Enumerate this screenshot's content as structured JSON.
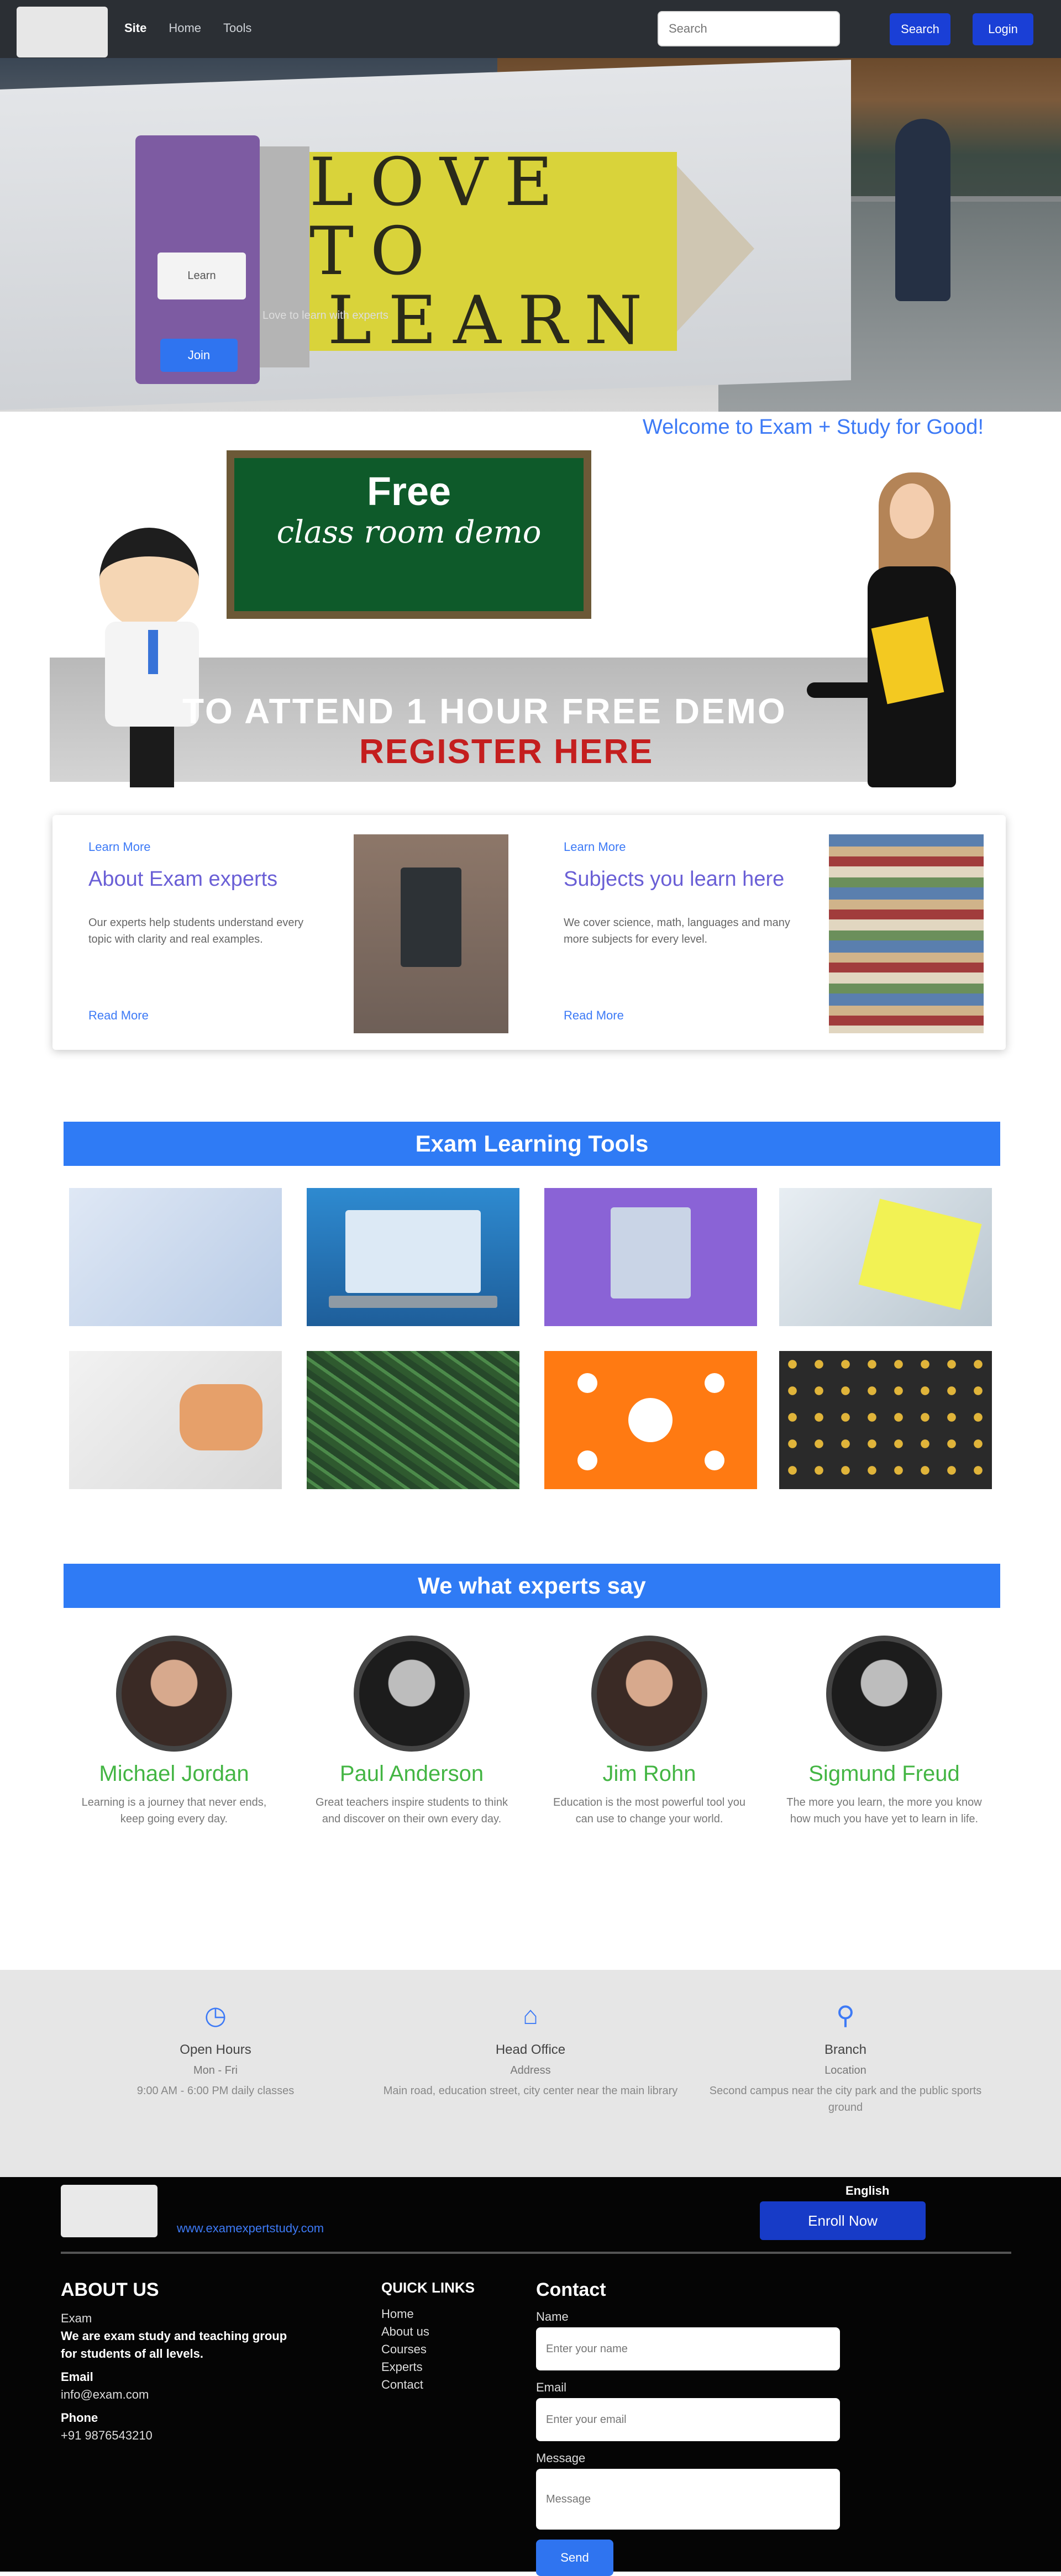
{
  "nav": {
    "links": [
      "Site",
      "Home",
      "Tools"
    ],
    "search_placeholder": "Search",
    "buttons": [
      "Search",
      "Login"
    ]
  },
  "hero": {
    "pencil_words": [
      "LOVE TO",
      "LEARN"
    ],
    "card_label": "Learn",
    "caption": "Love to learn with experts",
    "button_label": "Join",
    "welcome": "Welcome to Exam + Study for Good!"
  },
  "banner": {
    "chalk_line1": "Free",
    "chalk_line2": "class room demo",
    "line1": "TO ATTEND 1 HOUR FREE DEMO",
    "line2": "REGISTER HERE"
  },
  "info_cards": [
    {
      "tag": "Learn More",
      "title": "About Exam experts",
      "text": "Our experts help students understand every topic with clarity and real examples.",
      "more": "Read More"
    },
    {
      "tag": "Learn More",
      "title": "Subjects you learn here",
      "text": "We cover science, math, languages and many more subjects for every level.",
      "more": "Read More"
    }
  ],
  "sections": {
    "tools": "Exam Learning Tools",
    "experts": "We what experts say"
  },
  "tools": [
    "keyboard",
    "laptop",
    "certificate",
    "notes",
    "pencil-sketch",
    "chalkboard",
    "network",
    "gold-pattern"
  ],
  "experts": [
    {
      "name": "Michael Jordan",
      "quote": "Learning is a journey that never ends, keep going every day."
    },
    {
      "name": "Paul Anderson",
      "quote": "Great teachers inspire students to think and discover on their own every day."
    },
    {
      "name": "Jim Rohn",
      "quote": "Education is the most powerful tool you can use to change your world."
    },
    {
      "name": "Sigmund Freud",
      "quote": "The more you learn, the more you know how much you have yet to learn in life."
    }
  ],
  "contact_strip": [
    {
      "icon": "clock-icon",
      "title": "Open Hours",
      "sub": "Mon - Fri",
      "text": "9:00 AM - 6:00 PM daily classes"
    },
    {
      "icon": "home-icon",
      "title": "Head Office",
      "sub": "Address",
      "text": "Main road, education street, city center near the main library"
    },
    {
      "icon": "pin-icon",
      "title": "Branch",
      "sub": "Location",
      "text": "Second campus near the city park and the public sports ground"
    }
  ],
  "footer": {
    "link": "www.examexpertstudy.com",
    "lang": "English",
    "button": "Enroll Now",
    "about_title": "ABOUT US",
    "about_lines": [
      "Exam",
      "We are exam study and teaching group",
      "for students of all levels.",
      "Email",
      "info@exam.com",
      "Phone",
      "+91 9876543210"
    ],
    "links_title": "QUICK LINKS",
    "links": [
      "Home",
      "About us",
      "Courses",
      "Experts",
      "Contact"
    ],
    "contact_title": "Contact",
    "contact_labels": [
      "Name",
      "Email",
      "Message"
    ],
    "contact_placeholders": [
      "Enter your name",
      "Enter your email",
      "Message"
    ],
    "send": "Send"
  }
}
